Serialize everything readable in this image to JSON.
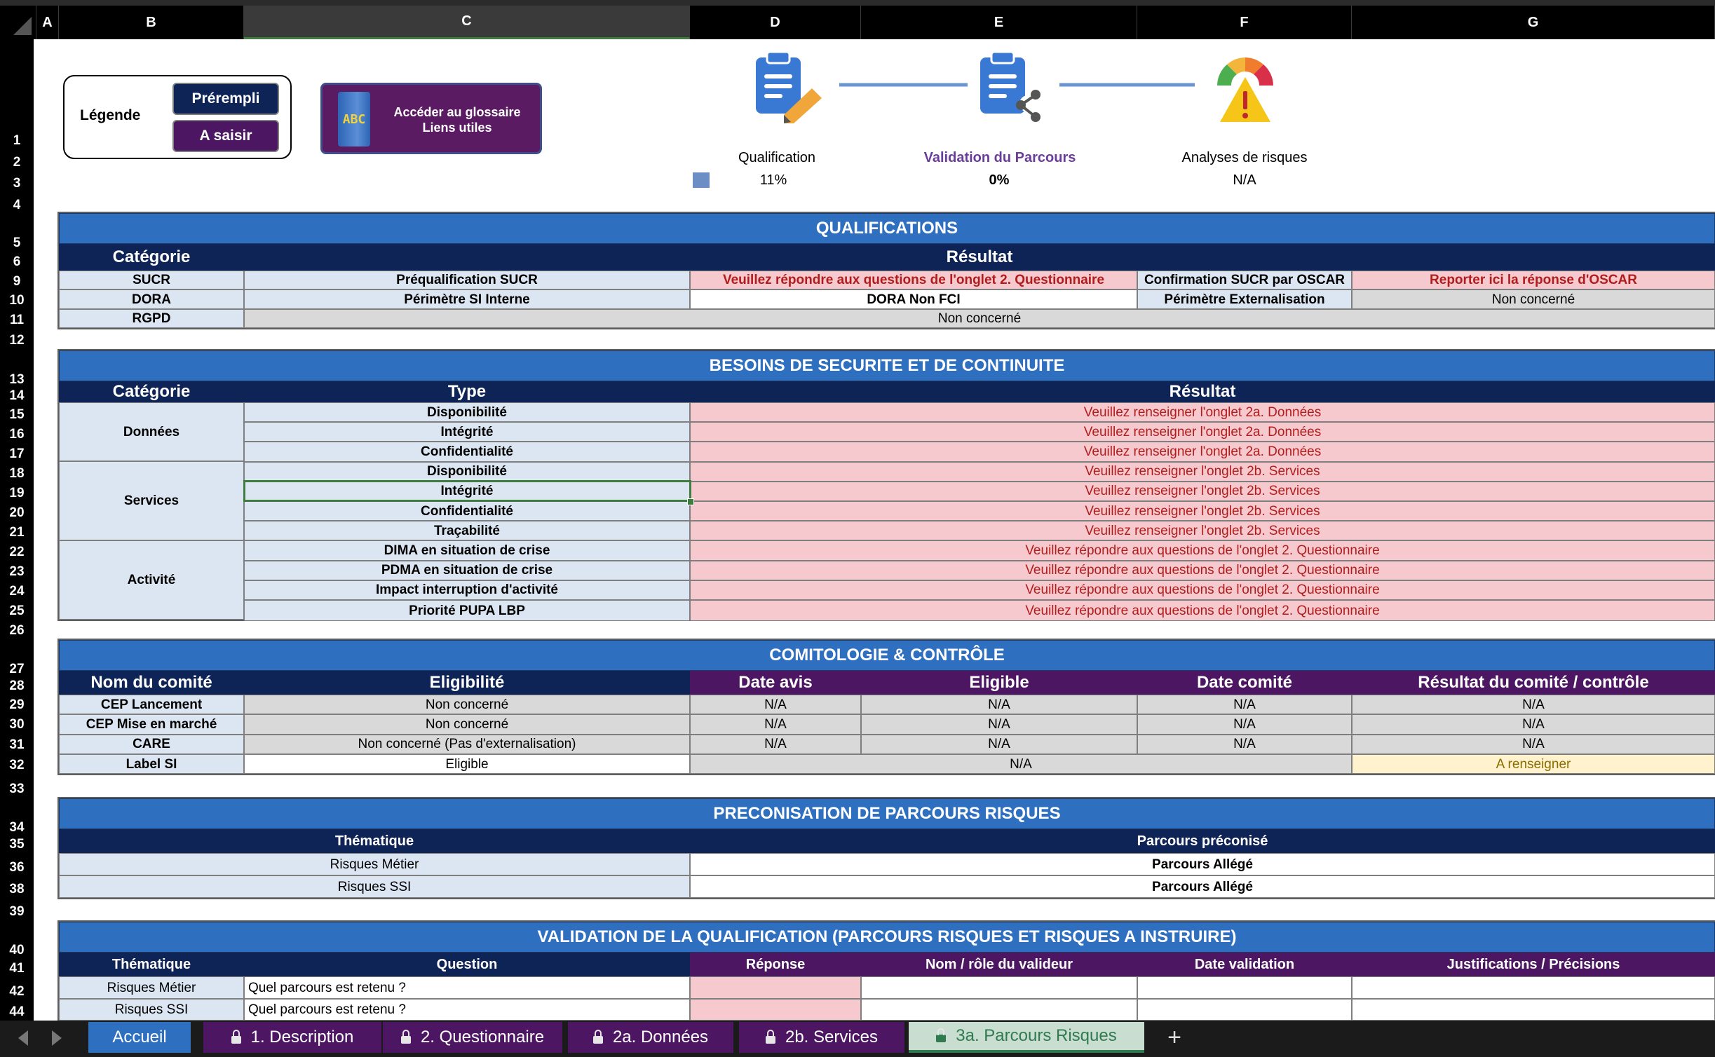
{
  "columns": [
    "A",
    "B",
    "C",
    "D",
    "E",
    "F",
    "G"
  ],
  "rows": [
    "1",
    "2",
    "3",
    "4",
    "5",
    "6",
    "9",
    "10",
    "11",
    "12",
    "13",
    "14",
    "15",
    "16",
    "17",
    "18",
    "19",
    "20",
    "21",
    "22",
    "23",
    "24",
    "25",
    "26",
    "27",
    "28",
    "29",
    "30",
    "31",
    "32",
    "33",
    "34",
    "35",
    "36",
    "38",
    "39",
    "40",
    "41",
    "42",
    "44"
  ],
  "legend": {
    "title": "Légende",
    "prefilled": "Prérempli",
    "to_enter": "A saisir"
  },
  "glossary": {
    "icon_text": "ABC",
    "line1": "Accéder au glossaire",
    "line2": "Liens utiles"
  },
  "steps": [
    {
      "label": "Qualification",
      "value": "11%"
    },
    {
      "label": "Validation du Parcours",
      "value": "0%"
    },
    {
      "label": "Analyses de risques",
      "value": "N/A"
    }
  ],
  "colors": {
    "accent_blue": "#2f6fc0",
    "navy": "#0e2356",
    "purple": "#4c1663",
    "pink": "#f5c9cd",
    "light_blue": "#dce6f3",
    "grey": "#d9d9d9",
    "tab_green": "#2f7a4f"
  },
  "qualifications": {
    "title": "QUALIFICATIONS",
    "h_category": "Catégorie",
    "h_result": "Résultat",
    "r_sucr": "SUCR",
    "r_sucr_pre": "Préqualification SUCR",
    "r_sucr_msg": "Veuillez répondre aux questions de l'onglet 2. Questionnaire",
    "r_sucr_conf": "Confirmation SUCR par OSCAR",
    "r_sucr_oscar": "Reporter ici la réponse d'OSCAR",
    "r_dora": "DORA",
    "r_dora_peri": "Périmètre SI Interne",
    "r_dora_val": "DORA Non FCI",
    "r_dora_ext": "Périmètre Externalisation",
    "r_dora_nc": "Non concerné",
    "r_rgpd": "RGPD",
    "r_rgpd_val": "Non concerné"
  },
  "besoins": {
    "title": "BESOINS DE SECURITE ET DE CONTINUITE",
    "h_category": "Catégorie",
    "h_type": "Type",
    "h_result": "Résultat",
    "g_donnees": "Données",
    "g_services": "Services",
    "g_activite": "Activité",
    "rows": [
      {
        "type": "Disponibilité",
        "result": "Veuillez renseigner l'onglet 2a. Données"
      },
      {
        "type": "Intégrité",
        "result": "Veuillez renseigner l'onglet 2a. Données"
      },
      {
        "type": "Confidentialité",
        "result": "Veuillez renseigner l'onglet 2a. Données"
      },
      {
        "type": "Disponibilité",
        "result": "Veuillez renseigner l'onglet 2b. Services"
      },
      {
        "type": "Intégrité",
        "result": "Veuillez renseigner l'onglet 2b. Services"
      },
      {
        "type": "Confidentialité",
        "result": "Veuillez renseigner l'onglet 2b. Services"
      },
      {
        "type": "Traçabilité",
        "result": "Veuillez renseigner l'onglet 2b. Services"
      },
      {
        "type": "DIMA en situation de crise",
        "result": "Veuillez répondre aux questions de l'onglet 2. Questionnaire"
      },
      {
        "type": "PDMA en situation de crise",
        "result": "Veuillez répondre aux questions de l'onglet 2. Questionnaire"
      },
      {
        "type": "Impact interruption d'activité",
        "result": "Veuillez répondre aux questions de l'onglet 2. Questionnaire"
      },
      {
        "type": "Priorité PUPA LBP",
        "result": "Veuillez répondre aux questions de l'onglet 2. Questionnaire"
      }
    ]
  },
  "comitologie": {
    "title": "COMITOLOGIE & CONTRÔLE",
    "headers": [
      "Nom du comité",
      "Eligibilité",
      "Date avis",
      "Eligible",
      "Date comité",
      "Résultat du comité / contrôle"
    ],
    "rows": [
      [
        "CEP Lancement",
        "Non concerné",
        "N/A",
        "N/A",
        "N/A",
        "N/A"
      ],
      [
        "CEP Mise en marché",
        "Non concerné",
        "N/A",
        "N/A",
        "N/A",
        "N/A"
      ],
      [
        "CARE",
        "Non concerné (Pas d'externalisation)",
        "N/A",
        "N/A",
        "N/A",
        "N/A"
      ]
    ],
    "label_si": "Label SI",
    "label_si_elig": "Eligible",
    "label_si_na": "N/A",
    "label_si_res": "A renseigner"
  },
  "preconisation": {
    "title": "PRECONISATION DE PARCOURS RISQUES",
    "h_theme": "Thématique",
    "h_parcours": "Parcours préconisé",
    "rows": [
      [
        "Risques Métier",
        "Parcours Allégé"
      ],
      [
        "Risques SSI",
        "Parcours Allégé"
      ]
    ]
  },
  "validation": {
    "title": "VALIDATION DE LA QUALIFICATION (PARCOURS RISQUES ET RISQUES A INSTRUIRE)",
    "headers": [
      "Thématique",
      "Question",
      "Réponse",
      "Nom / rôle du valideur",
      "Date validation",
      "Justifications / Précisions"
    ],
    "rows": [
      [
        "Risques Métier",
        "Quel parcours est retenu ?"
      ],
      [
        "Risques SSI",
        "Quel parcours est retenu ?"
      ]
    ]
  },
  "tabs": [
    "Accueil",
    "1. Description",
    "2. Questionnaire",
    "2a. Données",
    "2b. Services",
    "3a. Parcours Risques"
  ],
  "add_sheet": "+"
}
